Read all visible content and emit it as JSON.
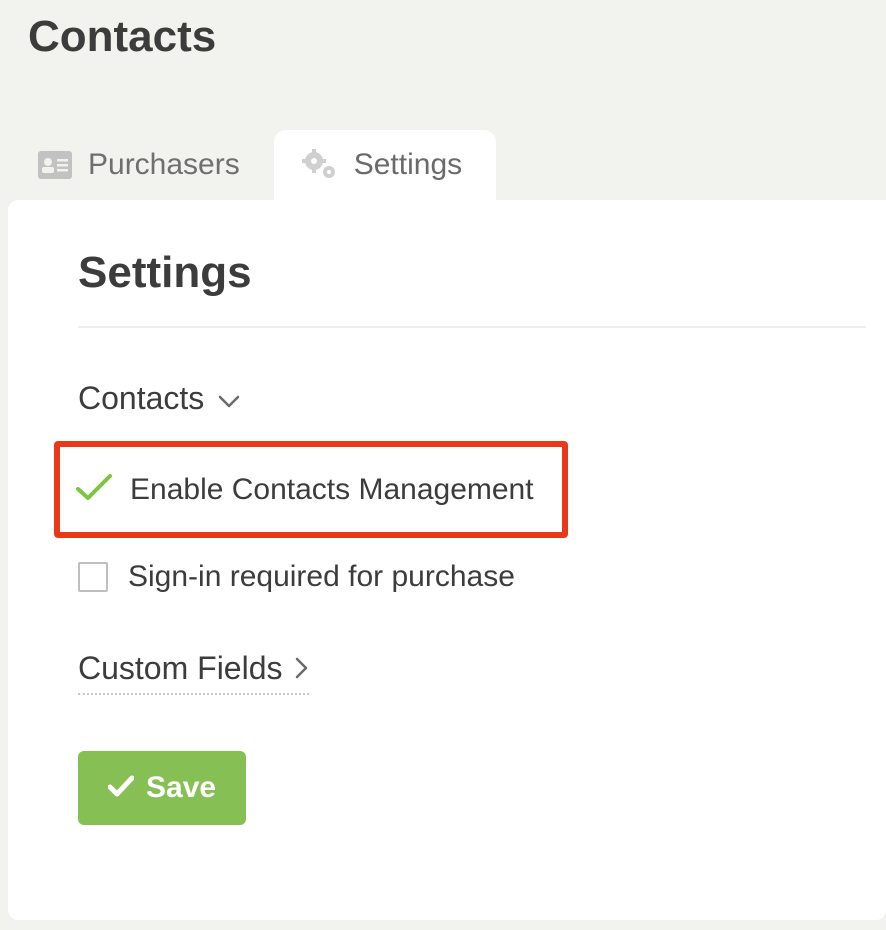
{
  "page": {
    "title": "Contacts"
  },
  "tabs": {
    "purchasers": {
      "label": "Purchasers"
    },
    "settings": {
      "label": "Settings"
    }
  },
  "panel": {
    "title": "Settings",
    "section_contacts_label": "Contacts",
    "option_enable_label": "Enable Contacts Management",
    "option_signin_label": "Sign-in required for purchase",
    "subsection_custom_fields_label": "Custom Fields",
    "save_button_label": "Save"
  }
}
